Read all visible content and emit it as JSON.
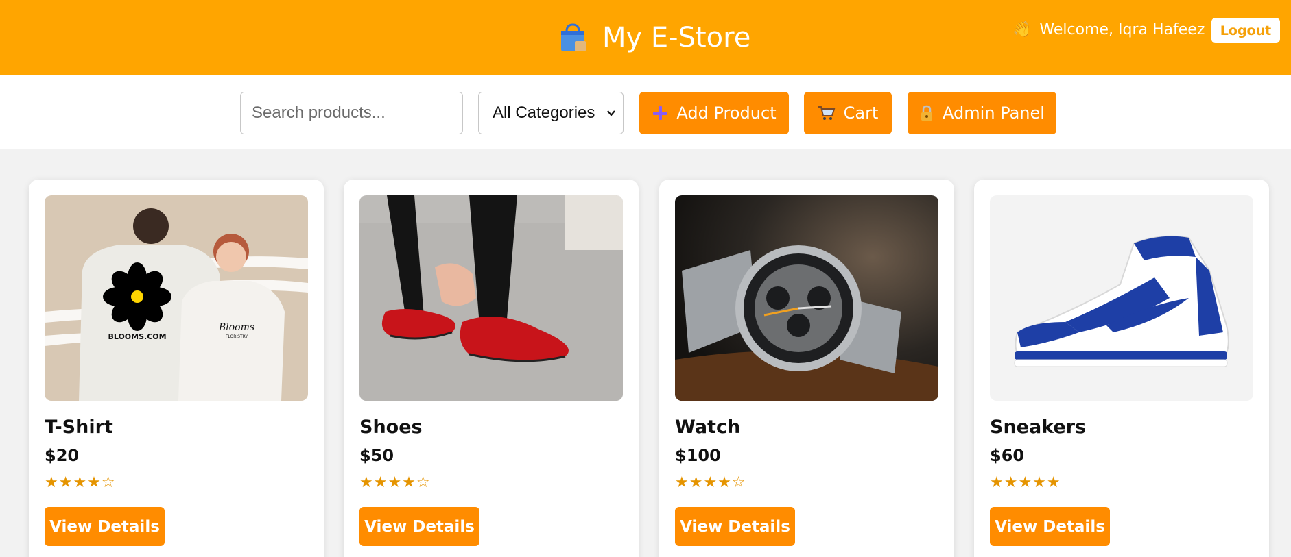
{
  "header": {
    "title": "My E-Store",
    "brand_icon": "shopping-bag-icon",
    "welcome_text": "Welcome, Iqra Hafeez",
    "welcome_icon": "waving-hand-icon",
    "logout_label": "Logout",
    "background_color": "#ffa500"
  },
  "toolbar": {
    "search_placeholder": "Search products...",
    "category_selected": "All Categories",
    "add_product_label": "Add Product",
    "add_product_icon": "plus-icon",
    "cart_label": "Cart",
    "cart_icon": "shopping-cart-icon",
    "admin_panel_label": "Admin Panel",
    "admin_panel_icon": "lock-icon",
    "button_color": "#ff8c00"
  },
  "products": [
    {
      "name": "T-Shirt",
      "price": "$20",
      "rating_stars": "★★★★☆",
      "rating": 4,
      "action_label": "View Details",
      "image": "tshirt-photo",
      "print_text": "BLOOMS.COM",
      "print_text_2": "Blooms",
      "print_text_3": "FLORISTRY"
    },
    {
      "name": "Shoes",
      "price": "$50",
      "rating_stars": "★★★★☆",
      "rating": 4,
      "action_label": "View Details",
      "image": "red-shoes-photo"
    },
    {
      "name": "Watch",
      "price": "$100",
      "rating_stars": "★★★★☆",
      "rating": 4,
      "action_label": "View Details",
      "image": "watch-photo"
    },
    {
      "name": "Sneakers",
      "price": "$60",
      "rating_stars": "★★★★★",
      "rating": 5,
      "action_label": "View Details",
      "image": "blue-sneaker-photo"
    }
  ]
}
